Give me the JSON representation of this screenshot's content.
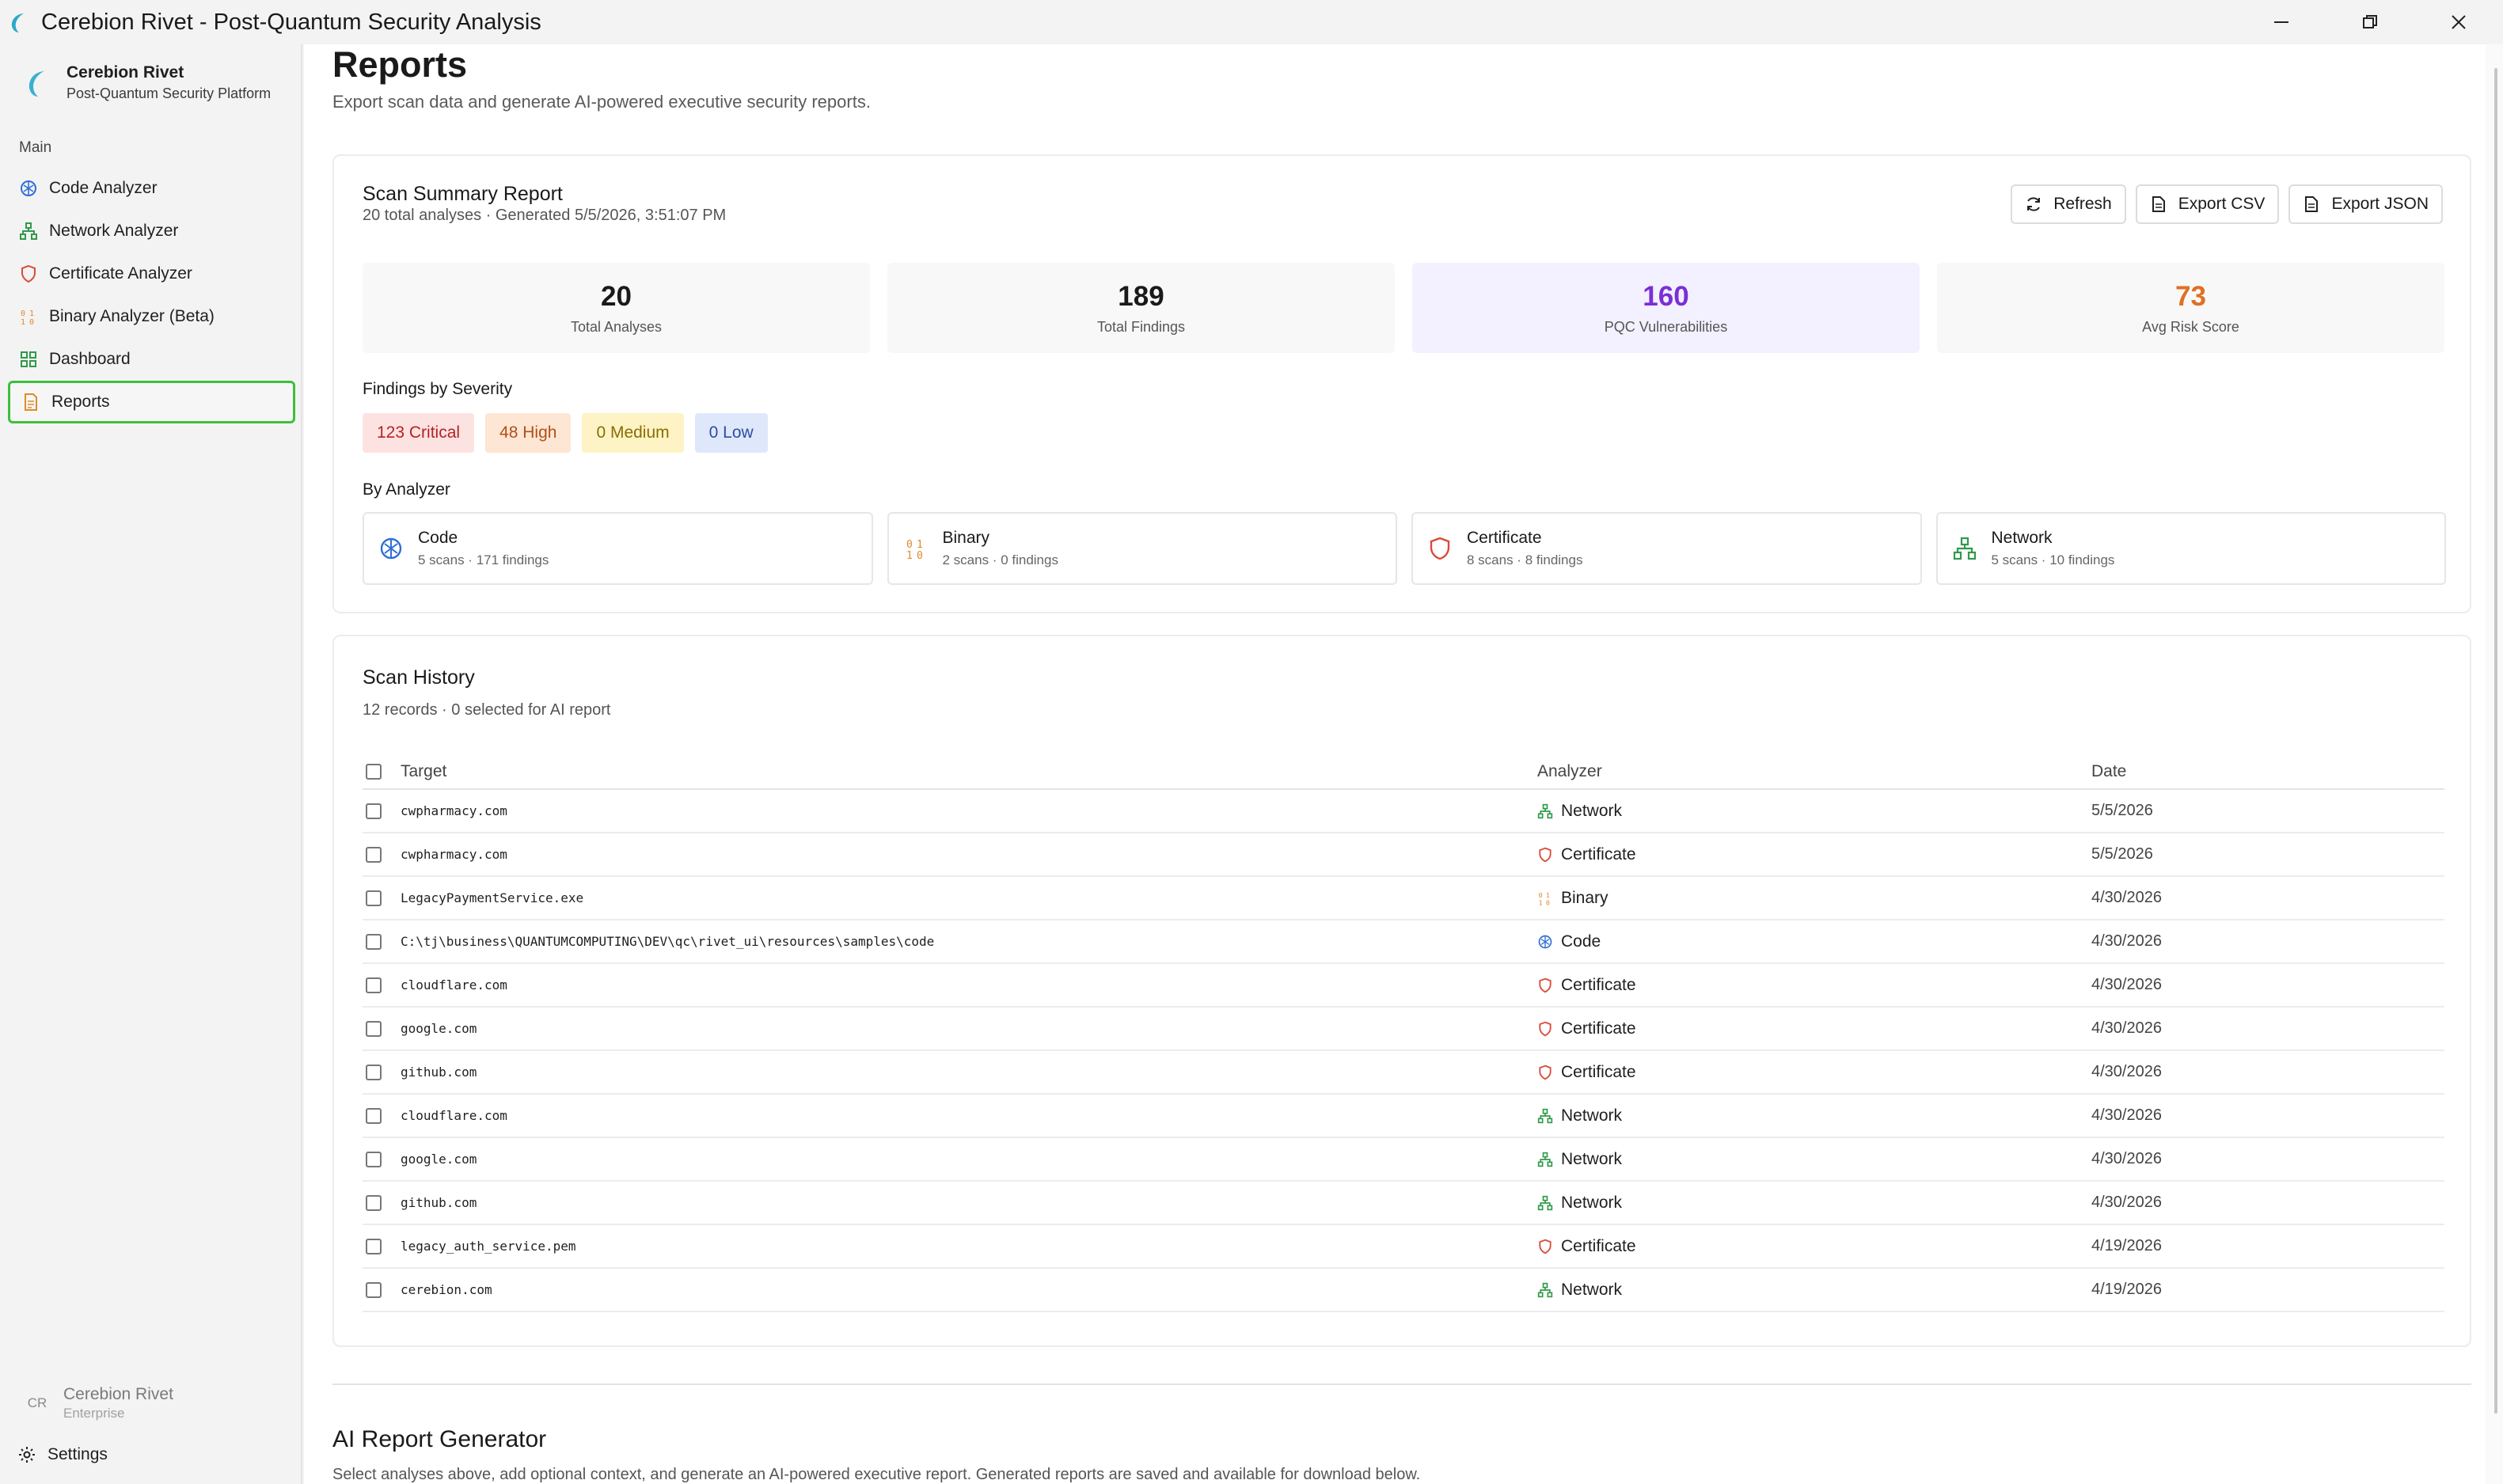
{
  "window": {
    "title": "Cerebion Rivet - Post-Quantum Security Analysis"
  },
  "sidebar": {
    "brand_name": "Cerebion Rivet",
    "brand_sub": "Post-Quantum Security Platform",
    "section": "Main",
    "items": [
      {
        "label": "Code Analyzer",
        "icon": "code-icon"
      },
      {
        "label": "Network Analyzer",
        "icon": "network-icon"
      },
      {
        "label": "Certificate Analyzer",
        "icon": "shield-icon"
      },
      {
        "label": "Binary Analyzer (Beta)",
        "icon": "binary-icon"
      },
      {
        "label": "Dashboard",
        "icon": "grid-icon"
      },
      {
        "label": "Reports",
        "icon": "document-icon",
        "active": true
      }
    ],
    "user": {
      "initials": "CR",
      "name": "Cerebion Rivet",
      "plan": "Enterprise"
    },
    "settings_label": "Settings"
  },
  "page": {
    "title": "Reports",
    "subtitle": "Export scan data and generate AI-powered executive security reports."
  },
  "summary": {
    "title": "Scan Summary Report",
    "subtitle": "20 total analyses · Generated 5/5/2026, 3:51:07 PM",
    "buttons": {
      "refresh": "Refresh",
      "export_csv": "Export CSV",
      "export_json": "Export JSON"
    },
    "stats": [
      {
        "value": "20",
        "label": "Total Analyses"
      },
      {
        "value": "189",
        "label": "Total Findings"
      },
      {
        "value": "160",
        "label": "PQC Vulnerabilities"
      },
      {
        "value": "73",
        "label": "Avg Risk Score"
      }
    ],
    "severity_label": "Findings by Severity",
    "severity": {
      "critical": "123 Critical",
      "high": "48 High",
      "medium": "0 Medium",
      "low": "0 Low"
    },
    "by_analyzer_label": "By Analyzer",
    "analyzers": [
      {
        "name": "Code",
        "meta": "5 scans · 171 findings",
        "icon": "code-icon"
      },
      {
        "name": "Binary",
        "meta": "2 scans · 0 findings",
        "icon": "binary-icon"
      },
      {
        "name": "Certificate",
        "meta": "8 scans · 8 findings",
        "icon": "shield-icon"
      },
      {
        "name": "Network",
        "meta": "5 scans · 10 findings",
        "icon": "network-icon"
      }
    ]
  },
  "history": {
    "title": "Scan History",
    "subtitle": "12 records · 0 selected for AI report",
    "columns": {
      "target": "Target",
      "analyzer": "Analyzer",
      "date": "Date"
    },
    "rows": [
      {
        "target": "cwpharmacy.com",
        "analyzer": "Network",
        "date": "5/5/2026"
      },
      {
        "target": "cwpharmacy.com",
        "analyzer": "Certificate",
        "date": "5/5/2026"
      },
      {
        "target": "LegacyPaymentService.exe",
        "analyzer": "Binary",
        "date": "4/30/2026"
      },
      {
        "target": "C:\\tj\\business\\QUANTUMCOMPUTING\\DEV\\qc\\rivet_ui\\resources\\samples\\code",
        "analyzer": "Code",
        "date": "4/30/2026"
      },
      {
        "target": "cloudflare.com",
        "analyzer": "Certificate",
        "date": "4/30/2026"
      },
      {
        "target": "google.com",
        "analyzer": "Certificate",
        "date": "4/30/2026"
      },
      {
        "target": "github.com",
        "analyzer": "Certificate",
        "date": "4/30/2026"
      },
      {
        "target": "cloudflare.com",
        "analyzer": "Network",
        "date": "4/30/2026"
      },
      {
        "target": "google.com",
        "analyzer": "Network",
        "date": "4/30/2026"
      },
      {
        "target": "github.com",
        "analyzer": "Network",
        "date": "4/30/2026"
      },
      {
        "target": "legacy_auth_service.pem",
        "analyzer": "Certificate",
        "date": "4/19/2026"
      },
      {
        "target": "cerebion.com",
        "analyzer": "Network",
        "date": "4/19/2026"
      }
    ]
  },
  "ai": {
    "title": "AI Report Generator",
    "subtitle": "Select analyses above, add optional context, and generate an AI-powered executive report. Generated reports are saved and available for download below."
  },
  "colors": {
    "accent": "#3cc03c",
    "purple": "#7b2fd6",
    "orange": "#e07020"
  }
}
